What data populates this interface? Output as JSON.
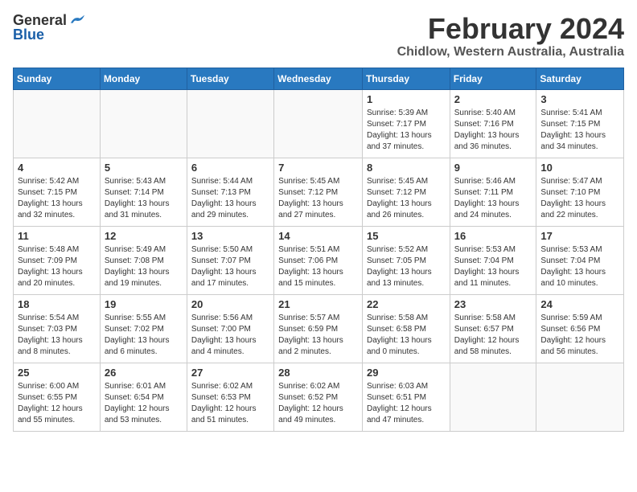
{
  "logo": {
    "general": "General",
    "blue": "Blue"
  },
  "title": "February 2024",
  "location": "Chidlow, Western Australia, Australia",
  "days_of_week": [
    "Sunday",
    "Monday",
    "Tuesday",
    "Wednesday",
    "Thursday",
    "Friday",
    "Saturday"
  ],
  "weeks": [
    [
      {
        "day": "",
        "info": ""
      },
      {
        "day": "",
        "info": ""
      },
      {
        "day": "",
        "info": ""
      },
      {
        "day": "",
        "info": ""
      },
      {
        "day": "1",
        "info": "Sunrise: 5:39 AM\nSunset: 7:17 PM\nDaylight: 13 hours\nand 37 minutes."
      },
      {
        "day": "2",
        "info": "Sunrise: 5:40 AM\nSunset: 7:16 PM\nDaylight: 13 hours\nand 36 minutes."
      },
      {
        "day": "3",
        "info": "Sunrise: 5:41 AM\nSunset: 7:15 PM\nDaylight: 13 hours\nand 34 minutes."
      }
    ],
    [
      {
        "day": "4",
        "info": "Sunrise: 5:42 AM\nSunset: 7:15 PM\nDaylight: 13 hours\nand 32 minutes."
      },
      {
        "day": "5",
        "info": "Sunrise: 5:43 AM\nSunset: 7:14 PM\nDaylight: 13 hours\nand 31 minutes."
      },
      {
        "day": "6",
        "info": "Sunrise: 5:44 AM\nSunset: 7:13 PM\nDaylight: 13 hours\nand 29 minutes."
      },
      {
        "day": "7",
        "info": "Sunrise: 5:45 AM\nSunset: 7:12 PM\nDaylight: 13 hours\nand 27 minutes."
      },
      {
        "day": "8",
        "info": "Sunrise: 5:45 AM\nSunset: 7:12 PM\nDaylight: 13 hours\nand 26 minutes."
      },
      {
        "day": "9",
        "info": "Sunrise: 5:46 AM\nSunset: 7:11 PM\nDaylight: 13 hours\nand 24 minutes."
      },
      {
        "day": "10",
        "info": "Sunrise: 5:47 AM\nSunset: 7:10 PM\nDaylight: 13 hours\nand 22 minutes."
      }
    ],
    [
      {
        "day": "11",
        "info": "Sunrise: 5:48 AM\nSunset: 7:09 PM\nDaylight: 13 hours\nand 20 minutes."
      },
      {
        "day": "12",
        "info": "Sunrise: 5:49 AM\nSunset: 7:08 PM\nDaylight: 13 hours\nand 19 minutes."
      },
      {
        "day": "13",
        "info": "Sunrise: 5:50 AM\nSunset: 7:07 PM\nDaylight: 13 hours\nand 17 minutes."
      },
      {
        "day": "14",
        "info": "Sunrise: 5:51 AM\nSunset: 7:06 PM\nDaylight: 13 hours\nand 15 minutes."
      },
      {
        "day": "15",
        "info": "Sunrise: 5:52 AM\nSunset: 7:05 PM\nDaylight: 13 hours\nand 13 minutes."
      },
      {
        "day": "16",
        "info": "Sunrise: 5:53 AM\nSunset: 7:04 PM\nDaylight: 13 hours\nand 11 minutes."
      },
      {
        "day": "17",
        "info": "Sunrise: 5:53 AM\nSunset: 7:04 PM\nDaylight: 13 hours\nand 10 minutes."
      }
    ],
    [
      {
        "day": "18",
        "info": "Sunrise: 5:54 AM\nSunset: 7:03 PM\nDaylight: 13 hours\nand 8 minutes."
      },
      {
        "day": "19",
        "info": "Sunrise: 5:55 AM\nSunset: 7:02 PM\nDaylight: 13 hours\nand 6 minutes."
      },
      {
        "day": "20",
        "info": "Sunrise: 5:56 AM\nSunset: 7:00 PM\nDaylight: 13 hours\nand 4 minutes."
      },
      {
        "day": "21",
        "info": "Sunrise: 5:57 AM\nSunset: 6:59 PM\nDaylight: 13 hours\nand 2 minutes."
      },
      {
        "day": "22",
        "info": "Sunrise: 5:58 AM\nSunset: 6:58 PM\nDaylight: 13 hours\nand 0 minutes."
      },
      {
        "day": "23",
        "info": "Sunrise: 5:58 AM\nSunset: 6:57 PM\nDaylight: 12 hours\nand 58 minutes."
      },
      {
        "day": "24",
        "info": "Sunrise: 5:59 AM\nSunset: 6:56 PM\nDaylight: 12 hours\nand 56 minutes."
      }
    ],
    [
      {
        "day": "25",
        "info": "Sunrise: 6:00 AM\nSunset: 6:55 PM\nDaylight: 12 hours\nand 55 minutes."
      },
      {
        "day": "26",
        "info": "Sunrise: 6:01 AM\nSunset: 6:54 PM\nDaylight: 12 hours\nand 53 minutes."
      },
      {
        "day": "27",
        "info": "Sunrise: 6:02 AM\nSunset: 6:53 PM\nDaylight: 12 hours\nand 51 minutes."
      },
      {
        "day": "28",
        "info": "Sunrise: 6:02 AM\nSunset: 6:52 PM\nDaylight: 12 hours\nand 49 minutes."
      },
      {
        "day": "29",
        "info": "Sunrise: 6:03 AM\nSunset: 6:51 PM\nDaylight: 12 hours\nand 47 minutes."
      },
      {
        "day": "",
        "info": ""
      },
      {
        "day": "",
        "info": ""
      }
    ]
  ]
}
